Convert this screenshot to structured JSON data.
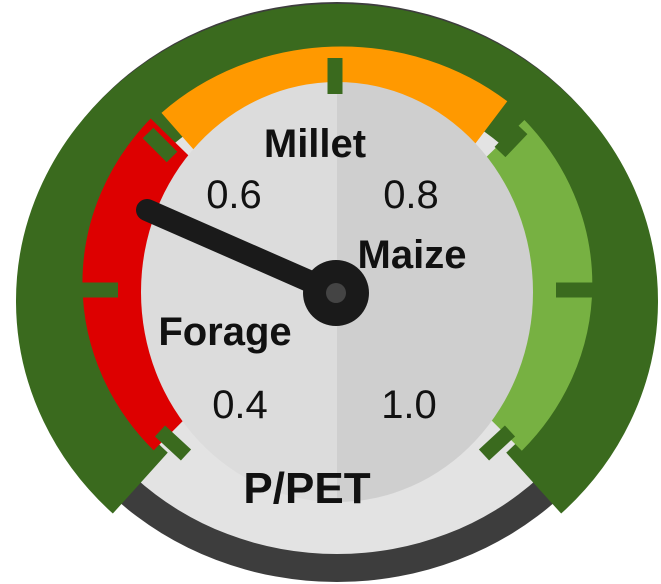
{
  "gauge": {
    "title": "P/PET",
    "needle_value": 0.52,
    "scale": {
      "labels": [
        {
          "name": "tick-label-0-4",
          "text": "0.4"
        },
        {
          "name": "tick-label-0-6",
          "text": "0.6"
        },
        {
          "name": "tick-label-0-8",
          "text": "0.8"
        },
        {
          "name": "tick-label-1-0",
          "text": "1.0"
        }
      ]
    },
    "crops": [
      {
        "name": "crop-label-forage",
        "text": "Forage"
      },
      {
        "name": "crop-label-millet",
        "text": "Millet"
      },
      {
        "name": "crop-label-maize",
        "text": "Maize"
      }
    ],
    "zones": [
      {
        "name": "red-zone-arc",
        "color": "#dd0000"
      },
      {
        "name": "orange-zone-arc",
        "color": "#ff9900"
      },
      {
        "name": "green-zone-arc",
        "color": "#77b142"
      }
    ],
    "colors": {
      "bezel": "#3d3d3d",
      "rim": "#e3e3e3",
      "band_border": "#3a6a1e",
      "face_left": "#dcdcdc",
      "face_right": "#cfcfcf",
      "needle": "#1a1a1a",
      "hub_dot": "#444444"
    }
  }
}
